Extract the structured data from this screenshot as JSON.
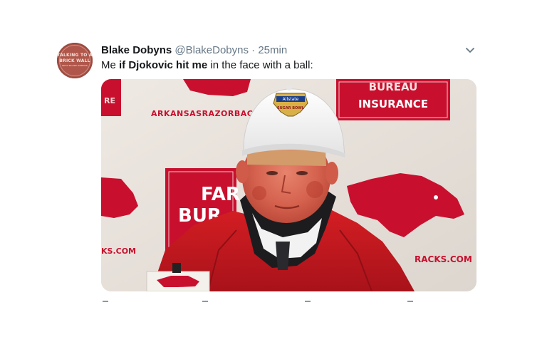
{
  "tweet": {
    "avatar": {
      "line1": "TALKING TO A",
      "line2": "BRICK WALL",
      "line3": "WITH BLAKE DOBYNS"
    },
    "author_name": "Blake Dobyns",
    "handle": "@BlakeDobyns",
    "separator": "·",
    "time": "25min",
    "text_pre": "Me ",
    "text_bold": "if Djokovic hit me",
    "text_post": " in the face with a ball:"
  },
  "media": {
    "backdrop": {
      "sponsor_top_right": "INSURANCE",
      "sponsor_top_right_partial": "BUREAU",
      "web_top_left": "ARKANSASRAZORBACKS",
      "sponsor_mid_line1": "FAR",
      "sponsor_mid_line2": "BUR",
      "web_left": "KS.COM",
      "web_right": "RACKS.COM",
      "small_left": "RE"
    },
    "cap_logo_line1": "Allstate",
    "cap_logo_line2": "SUGAR BOWL"
  },
  "colors": {
    "text_primary": "#14171a",
    "text_secondary": "#657786",
    "razorback_red": "#c8102e",
    "jacket_red": "#c4161c"
  },
  "icons": {
    "menu": "chevron-down-icon"
  }
}
